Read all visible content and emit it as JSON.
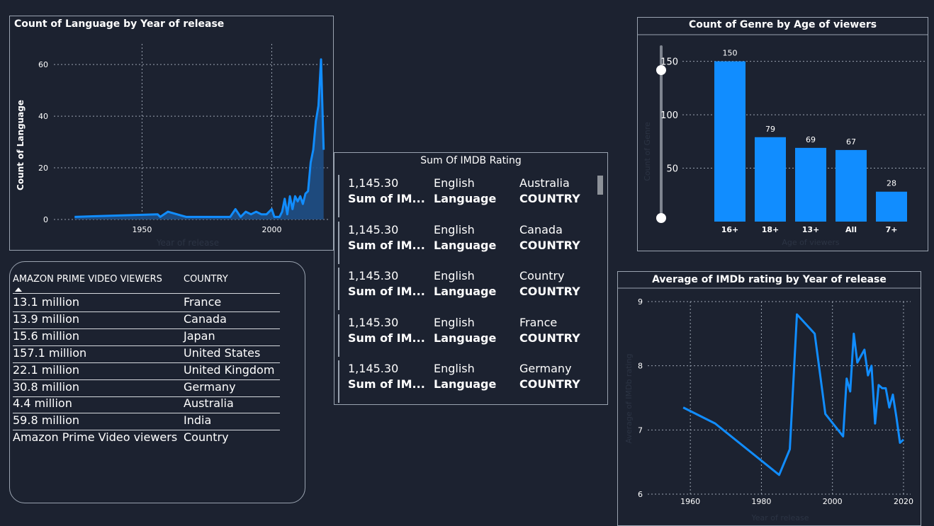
{
  "line_chart_1": {
    "title": "Count of Language by Year of release",
    "xlabel": "Year of release",
    "ylabel": "Count of Language"
  },
  "table": {
    "headers": [
      "AMAZON PRIME VIDEO VIEWERS",
      "COUNTRY"
    ],
    "rows": [
      [
        "13.1 million",
        "France"
      ],
      [
        "13.9 million",
        "Canada"
      ],
      [
        "15.6 million",
        "Japan"
      ],
      [
        "157.1 million",
        "United States"
      ],
      [
        "22.1 million",
        "United Kingdom"
      ],
      [
        "30.8 million",
        "Germany"
      ],
      [
        "4.4 million",
        "Australia"
      ],
      [
        "59.8 million",
        "India"
      ]
    ],
    "footer": [
      "Amazon Prime Video viewers",
      "Country"
    ]
  },
  "card": {
    "title": "Sum Of IMDB Rating",
    "rows": [
      {
        "value": "1,145.30",
        "label": "Sum of IM...",
        "language": "English",
        "language_label": "Language",
        "country": "Australia",
        "country_label": "COUNTRY"
      },
      {
        "value": "1,145.30",
        "label": "Sum of IM...",
        "language": "English",
        "language_label": "Language",
        "country": "Canada",
        "country_label": "COUNTRY"
      },
      {
        "value": "1,145.30",
        "label": "Sum of IM...",
        "language": "English",
        "language_label": "Language",
        "country": "Country",
        "country_label": "COUNTRY"
      },
      {
        "value": "1,145.30",
        "label": "Sum of IM...",
        "language": "English",
        "language_label": "Language",
        "country": "France",
        "country_label": "COUNTRY"
      },
      {
        "value": "1,145.30",
        "label": "Sum of IM...",
        "language": "English",
        "language_label": "Language",
        "country": "Germany",
        "country_label": "COUNTRY"
      }
    ]
  },
  "bar_chart": {
    "title": "Count of Genre by Age of viewers",
    "xlabel": "Age of viewers",
    "ylabel": "Count of Genre"
  },
  "line_chart_2": {
    "title": "Average of IMDb rating by Year of release",
    "xlabel": "Year of release",
    "ylabel": "Average of IMDb rating"
  },
  "colors": {
    "series": "#118dff",
    "area": "#1f4f86",
    "text": "#ffffff",
    "axis_label": "#2c3444",
    "grid": "#9aa3b0"
  },
  "chart_data": [
    {
      "type": "area",
      "title": "Count of Language by Year of release",
      "xlabel": "Year of release",
      "ylabel": "Count of Language",
      "xlim": [
        1916,
        2022
      ],
      "ylim": [
        0,
        68
      ],
      "x_ticks": [
        1950,
        2000
      ],
      "y_ticks": [
        0,
        20,
        40,
        60
      ],
      "grid": true,
      "x": [
        1924,
        1940,
        1956,
        1957,
        1960,
        1967,
        1975,
        1984,
        1986,
        1988,
        1990,
        1992,
        1994,
        1996,
        1998,
        2000,
        2001,
        2003,
        2004,
        2005,
        2006,
        2007,
        2008,
        2009,
        2010,
        2011,
        2012,
        2013,
        2014,
        2015,
        2016,
        2017,
        2018,
        2019,
        2020
      ],
      "values": [
        1,
        1.5,
        2,
        1,
        3,
        1,
        1,
        1,
        4,
        1,
        3,
        2,
        3,
        2,
        2,
        4,
        1,
        1,
        3,
        8,
        2,
        9,
        4,
        9,
        7,
        9,
        6,
        10,
        11,
        22,
        27,
        38,
        44,
        62,
        27
      ]
    },
    {
      "type": "bar",
      "title": "Count of Genre by Age of viewers",
      "xlabel": "Age of viewers",
      "ylabel": "Count of Genre",
      "categories": [
        "16+",
        "18+",
        "13+",
        "All",
        "7+"
      ],
      "values": [
        150,
        79,
        69,
        67,
        28
      ],
      "ylim": [
        0,
        165
      ],
      "y_ticks": [
        50,
        100,
        150
      ],
      "grid": true
    },
    {
      "type": "line",
      "title": "Average of IMDb rating by Year of release",
      "xlabel": "Year of release",
      "ylabel": "Average of IMDb rating",
      "xlim": [
        1948,
        2022
      ],
      "ylim": [
        6,
        9
      ],
      "x_ticks": [
        1960,
        1980,
        2000,
        2020
      ],
      "y_ticks": [
        6,
        7,
        8,
        9
      ],
      "grid": true,
      "x": [
        1958,
        1967,
        1985,
        1988,
        1990,
        1995,
        1998,
        2003,
        2004,
        2005,
        2006,
        2007,
        2009,
        2010,
        2011,
        2012,
        2013,
        2014,
        2015,
        2016,
        2017,
        2018,
        2019,
        2020
      ],
      "values": [
        7.35,
        7.1,
        6.3,
        6.7,
        8.8,
        8.5,
        7.25,
        6.9,
        7.8,
        7.6,
        8.5,
        8.05,
        8.25,
        7.85,
        8.0,
        7.1,
        7.7,
        7.65,
        7.65,
        7.35,
        7.55,
        7.2,
        6.8,
        6.85
      ]
    }
  ]
}
